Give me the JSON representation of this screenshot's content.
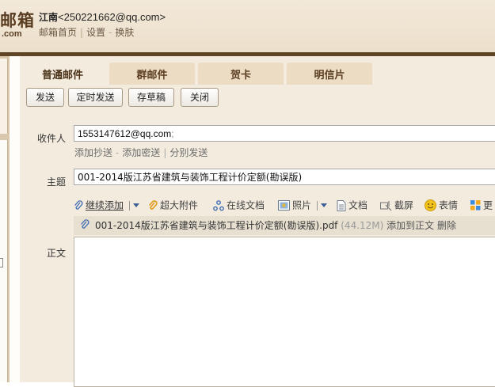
{
  "header": {
    "logo_main": "邮箱",
    "logo_sub": ".com",
    "user_name": "江南",
    "user_email": "<250221662@qq.com>",
    "links": [
      "邮箱首页",
      "设置",
      "换肤"
    ],
    "link_separators": [
      "|",
      "-"
    ]
  },
  "tabs": [
    {
      "label": "普通邮件",
      "active": true
    },
    {
      "label": "群邮件",
      "active": false
    },
    {
      "label": "贺卡",
      "active": false
    },
    {
      "label": "明信片",
      "active": false
    }
  ],
  "buttons": {
    "send": "发送",
    "scheduled_send": "定时发送",
    "save_draft": "存草稿",
    "close": "关闭"
  },
  "form": {
    "recipient_label": "收件人",
    "recipient_value": "1553147612@qq.com",
    "recipient_separator": ";",
    "add_cc": "添加抄送",
    "add_bcc": "添加密送",
    "split_send": "分别发送",
    "sublink_separators": [
      "-",
      "|"
    ],
    "subject_label": "主题",
    "subject_value": "001-2014版江苏省建筑与装饰工程计价定额(勘误版)",
    "body_label": "正文"
  },
  "attach_toolbar": {
    "continue_add": "继续添加",
    "super_attachment": "超大附件",
    "online_doc": "在线文档",
    "photo": "照片",
    "document": "文档",
    "screenshot": "截屏",
    "emoji": "表情",
    "more": "更"
  },
  "attachment": {
    "filename": "001-2014版江苏省建筑与装饰工程计价定额(勘误版).pdf",
    "size": "(44.12M)",
    "add_to_body": "添加到正文",
    "delete": "删除"
  },
  "colors": {
    "header_bg": "#efe4d3",
    "brown_bar": "#5f4526",
    "tab_bg": "#ecdcc3",
    "compose_bg": "#f3ebde",
    "icon_blue": "#3d6cb5",
    "icon_yellow": "#f3c31d"
  }
}
